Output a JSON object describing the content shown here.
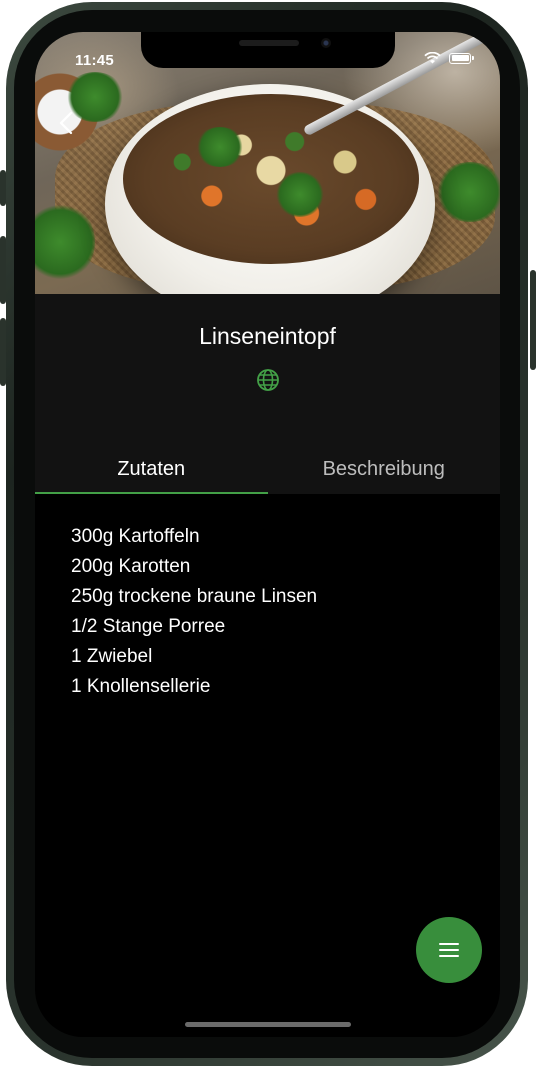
{
  "status_bar": {
    "time": "11:45"
  },
  "recipe": {
    "title": "Linseneintopf"
  },
  "tabs": [
    {
      "label": "Zutaten",
      "active": true
    },
    {
      "label": "Beschreibung",
      "active": false
    }
  ],
  "ingredients": [
    "300g Kartoffeln",
    "200g Karotten",
    "250g trockene braune Linsen",
    "1/2 Stange Porree",
    "1 Zwiebel",
    "1 Knollensellerie"
  ],
  "icons": {
    "back": "chevron-left-icon",
    "globe": "globe-icon",
    "fab": "menu-icon"
  },
  "colors": {
    "accent": "#43a047",
    "fab": "#388e3c",
    "header_bg": "#121212",
    "background": "#000000"
  }
}
